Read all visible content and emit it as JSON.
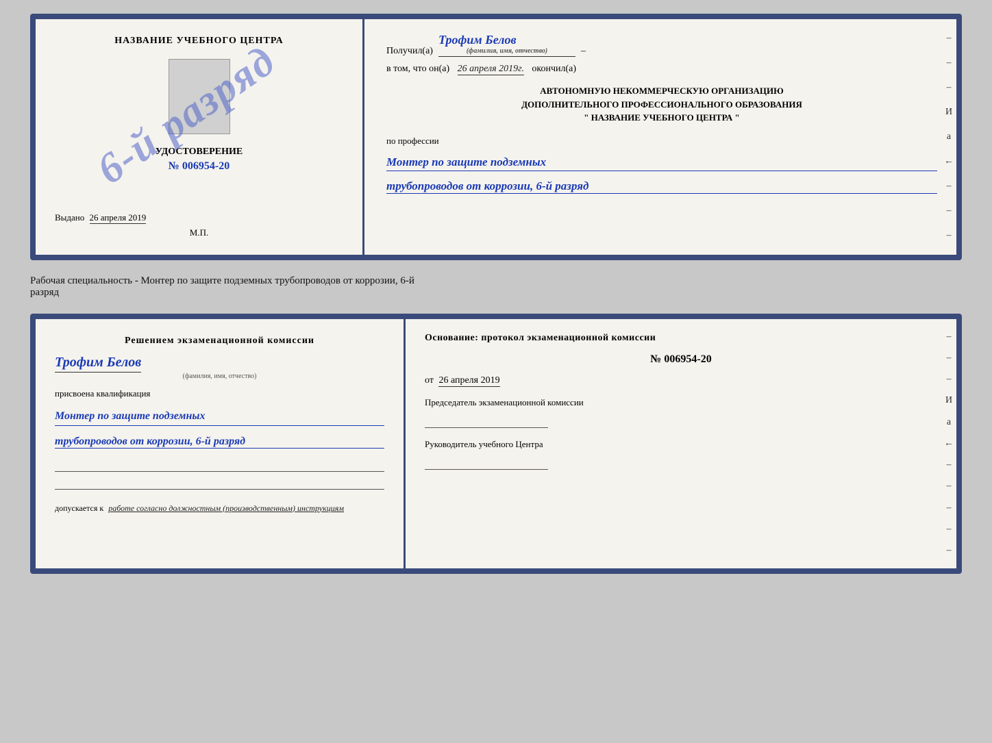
{
  "top_cert": {
    "left": {
      "title": "НАЗВАНИЕ УЧЕБНОГО ЦЕНТРА",
      "stamp_text": "6-й разряд",
      "udostoverenie_label": "УДОСТОВЕРЕНИЕ",
      "cert_number": "№ 006954-20",
      "issued_label": "Выдано",
      "issued_date": "26 апреля 2019",
      "mp_label": "М.П."
    },
    "right": {
      "received_label": "Получил(а)",
      "recipient_name": "Трофим Белов",
      "fio_hint": "(фамилия, имя, отчество)",
      "date_prefix": "в том, что он(а)",
      "date_value": "26 апреля 2019г.",
      "date_suffix": "окончил(а)",
      "org_line1": "АВТОНОМНУЮ НЕКОММЕРЧЕСКУЮ ОРГАНИЗАЦИЮ",
      "org_line2": "ДОПОЛНИТЕЛЬНОГО ПРОФЕССИОНАЛЬНОГО ОБРАЗОВАНИЯ",
      "org_line3": "\" НАЗВАНИЕ УЧЕБНОГО ЦЕНТРА \"",
      "profession_label": "по профессии",
      "profession_line1": "Монтер по защите подземных",
      "profession_line2": "трубопроводов от коррозии, 6-й разряд",
      "side_dashes": [
        "–",
        "–",
        "–",
        "И",
        "а",
        "←",
        "–",
        "–",
        "–"
      ]
    }
  },
  "middle": {
    "text_line1": "Рабочая специальность - Монтер по защите подземных трубопроводов от коррозии, 6-й",
    "text_line2": "разряд"
  },
  "bottom_cert": {
    "left": {
      "decision_title": "Решением экзаменационной комиссии",
      "person_name": "Трофим Белов",
      "fio_hint": "(фамилия, имя, отчество)",
      "qualification_label": "присвоена квалификация",
      "qualification_line1": "Монтер по защите подземных",
      "qualification_line2": "трубопроводов от коррозии, 6-й разряд",
      "work_permission_prefix": "допускается к",
      "work_permission_text": "работе согласно должностным (производственным) инструкциям"
    },
    "right": {
      "basis_label": "Основание: протокол экзаменационной комиссии",
      "protocol_no": "№ 006954-20",
      "protocol_date_prefix": "от",
      "protocol_date": "26 апреля 2019",
      "chairman_label": "Председатель экзаменационной комиссии",
      "director_label": "Руководитель учебного Центра",
      "side_dashes": [
        "–",
        "–",
        "–",
        "И",
        "а",
        "←",
        "–",
        "–",
        "–",
        "–",
        "–"
      ]
    }
  }
}
